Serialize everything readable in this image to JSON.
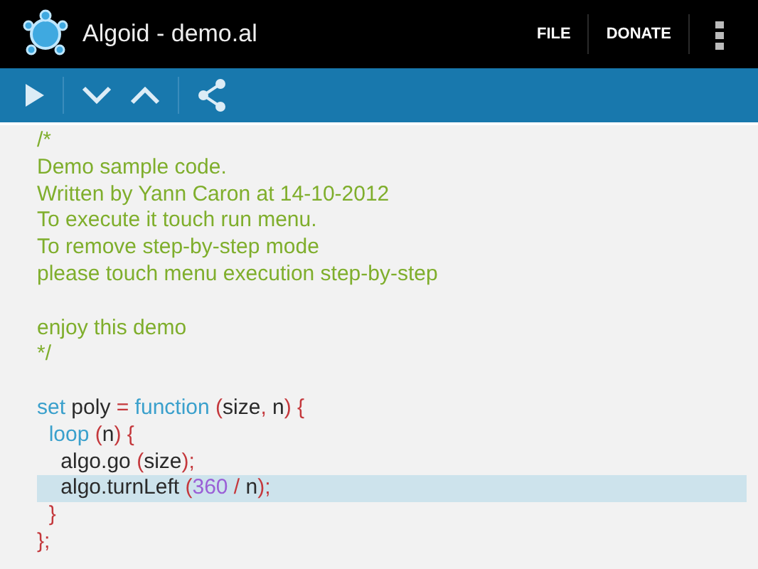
{
  "app_bar": {
    "title": "Algoid - demo.al",
    "actions": [
      "FILE",
      "DONATE"
    ]
  },
  "toolbar": {
    "buttons": [
      {
        "kind": "run"
      },
      {
        "kind": "down"
      },
      {
        "kind": "up"
      },
      {
        "kind": "share"
      }
    ]
  },
  "editor": {
    "lines": [
      {
        "highlighted": false,
        "tokens": [
          {
            "kind": "comment",
            "text": "/*"
          }
        ]
      },
      {
        "highlighted": false,
        "tokens": [
          {
            "kind": "comment",
            "text": "Demo sample code."
          }
        ]
      },
      {
        "highlighted": false,
        "tokens": [
          {
            "kind": "comment",
            "text": "Written by Yann Caron at 14-10-2012"
          }
        ]
      },
      {
        "highlighted": false,
        "tokens": [
          {
            "kind": "comment",
            "text": "To execute it touch run menu."
          }
        ]
      },
      {
        "highlighted": false,
        "tokens": [
          {
            "kind": "comment",
            "text": "To remove step-by-step mode"
          }
        ]
      },
      {
        "highlighted": false,
        "tokens": [
          {
            "kind": "comment",
            "text": "please touch menu execution step-by-step"
          }
        ]
      },
      {
        "kind": "blank"
      },
      {
        "highlighted": false,
        "tokens": [
          {
            "kind": "comment",
            "text": "enjoy this demo"
          }
        ]
      },
      {
        "highlighted": false,
        "tokens": [
          {
            "kind": "comment",
            "text": "*/"
          }
        ]
      },
      {
        "kind": "blank"
      },
      {
        "highlighted": false,
        "tokens": [
          {
            "kind": "keyword",
            "text": "set"
          },
          {
            "kind": "ident",
            "text": " poly "
          },
          {
            "kind": "punct",
            "text": "="
          },
          {
            "kind": "keyword",
            "text": " function "
          },
          {
            "kind": "punct",
            "text": "("
          },
          {
            "kind": "ident",
            "text": "size"
          },
          {
            "kind": "punct",
            "text": ","
          },
          {
            "kind": "ident",
            "text": " n"
          },
          {
            "kind": "punct",
            "text": ") {"
          }
        ]
      },
      {
        "highlighted": false,
        "tokens": [
          {
            "kind": "keyword",
            "text": "  loop "
          },
          {
            "kind": "punct",
            "text": "("
          },
          {
            "kind": "ident",
            "text": "n"
          },
          {
            "kind": "punct",
            "text": ") {"
          }
        ]
      },
      {
        "highlighted": false,
        "tokens": [
          {
            "kind": "ident",
            "text": "    algo.go "
          },
          {
            "kind": "punct",
            "text": "("
          },
          {
            "kind": "ident",
            "text": "size"
          },
          {
            "kind": "punct",
            "text": ");"
          }
        ]
      },
      {
        "highlighted": true,
        "tokens": [
          {
            "kind": "ident",
            "text": "    algo.turnLeft "
          },
          {
            "kind": "punct",
            "text": "("
          },
          {
            "kind": "number",
            "text": "360"
          },
          {
            "kind": "punct",
            "text": " / "
          },
          {
            "kind": "ident",
            "text": "n"
          },
          {
            "kind": "punct",
            "text": ");"
          }
        ]
      },
      {
        "highlighted": false,
        "tokens": [
          {
            "kind": "punct",
            "text": "  }"
          }
        ]
      },
      {
        "highlighted": false,
        "tokens": [
          {
            "kind": "punct",
            "text": "};"
          }
        ]
      }
    ]
  }
}
